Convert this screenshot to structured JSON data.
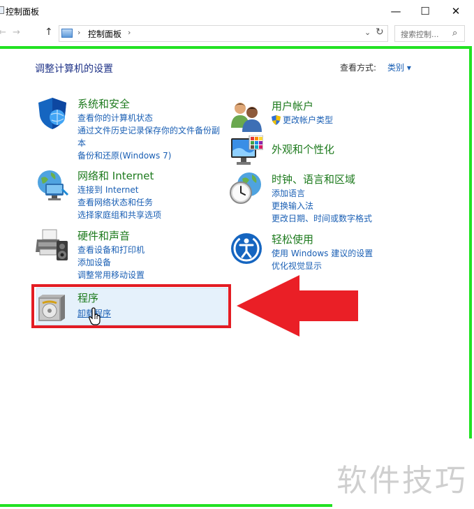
{
  "window": {
    "title": "控制面板",
    "minimize": "—",
    "maximize": "☐",
    "close": "✕"
  },
  "address": {
    "back": "←",
    "forward": "→",
    "up": "↑",
    "path": "控制面板",
    "separator": "›",
    "dropdown": "⌄",
    "refresh": "↻",
    "search_placeholder": "搜索控制...",
    "search_icon": "⌕"
  },
  "header": {
    "title": "调整计算机的设置",
    "view_by_label": "查看方式:",
    "view_by_value": "类别 ▾"
  },
  "categories": {
    "security": {
      "icon": "shield-icon",
      "title": "系统和安全",
      "links": [
        "查看你的计算机状态",
        "通过文件历史记录保存你的文件备份副本",
        "备份和还原(Windows 7)"
      ]
    },
    "network": {
      "icon": "network-globe-icon",
      "title": "网络和 Internet",
      "links": [
        "连接到 Internet",
        "查看网络状态和任务",
        "选择家庭组和共享选项"
      ]
    },
    "hardware": {
      "icon": "printer-speaker-icon",
      "title": "硬件和声音",
      "links": [
        "查看设备和打印机",
        "添加设备",
        "调整常用移动设置"
      ]
    },
    "programs": {
      "icon": "programs-disc-icon",
      "title": "程序",
      "links": [
        "卸载程序"
      ]
    },
    "user_accounts": {
      "icon": "users-icon",
      "title": "用户帐户",
      "links": [
        "更改帐户类型"
      ]
    },
    "appearance": {
      "icon": "monitor-palette-icon",
      "title": "外观和个性化",
      "links": []
    },
    "clock": {
      "icon": "clock-globe-icon",
      "title": "时钟、语言和区域",
      "links": [
        "添加语言",
        "更换输入法",
        "更改日期、时间或数字格式"
      ]
    },
    "ease": {
      "icon": "ease-of-access-icon",
      "title": "轻松使用",
      "links": [
        "使用 Windows 建议的设置",
        "优化视觉显示"
      ]
    }
  },
  "colors": {
    "category_title": "#1d7a1d",
    "link": "#1a5fb4",
    "highlight_box": "#e31c23",
    "frame": "#22e222"
  },
  "watermark": "软件技巧"
}
